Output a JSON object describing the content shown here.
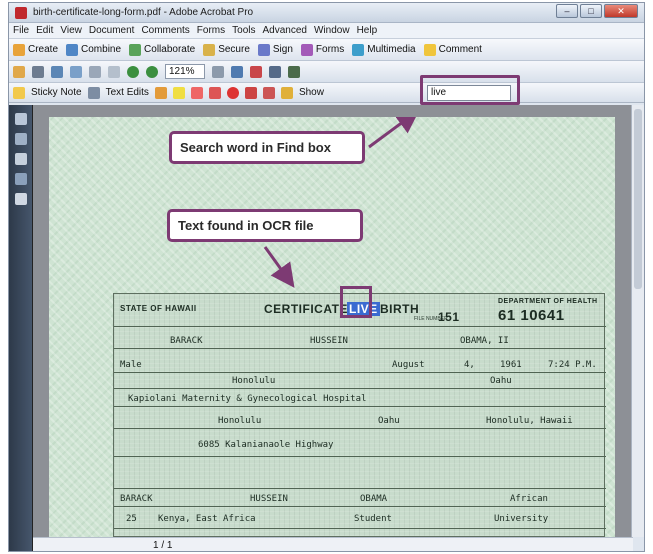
{
  "window": {
    "title": "birth-certificate-long-form.pdf - Adobe Acrobat Pro",
    "buttons": [
      "–",
      "□",
      "✕"
    ]
  },
  "menu": [
    "File",
    "Edit",
    "View",
    "Document",
    "Comments",
    "Forms",
    "Tools",
    "Advanced",
    "Window",
    "Help"
  ],
  "toolbar1": {
    "create": "Create",
    "combine": "Combine",
    "collaborate": "Collaborate",
    "secure": "Secure",
    "sign": "Sign",
    "forms": "Forms",
    "multimedia": "Multimedia",
    "comment": "Comment"
  },
  "toolbar2": {
    "zoom": "121%"
  },
  "toolbar3": {
    "sticky_note": "Sticky Note",
    "text_edits": "Text Edits",
    "show": "Show",
    "find_value": "live"
  },
  "callouts": {
    "search": "Search word in Find box",
    "found": "Text found in OCR file"
  },
  "certificate": {
    "state": "STATE OF HAWAII",
    "title_pre": "CERTIFICATE OF",
    "title_live": "LIVE",
    "title_post": "BIRTH",
    "dept": "DEPARTMENT OF HEALTH",
    "file_label": "FILE NUMBER",
    "file_prefix": "151",
    "file_number": "61 10641",
    "first_name": "BARACK",
    "middle_name": "HUSSEIN",
    "last_name": "OBAMA, II",
    "sex": "Male",
    "month": "August",
    "day": "4,",
    "year": "1961",
    "hour": "7:24 P.M.",
    "city": "Honolulu",
    "island": "Oahu",
    "hospital": "Kapiolani Maternity & Gynecological Hospital",
    "residence_city": "Honolulu",
    "residence_island": "Oahu",
    "residence_state": "Honolulu, Hawaii",
    "street": "6085 Kalanianaole Highway",
    "father_first": "BARACK",
    "father_middle": "HUSSEIN",
    "father_last": "OBAMA",
    "father_race": "African",
    "father_age": "25",
    "father_birthplace": "Kenya, East Africa",
    "father_occupation": "Student",
    "father_industry": "University"
  },
  "status": {
    "page": "1 / 1"
  }
}
